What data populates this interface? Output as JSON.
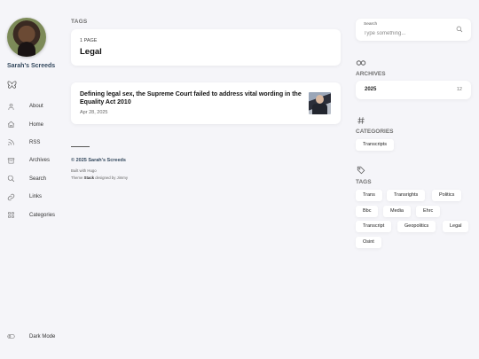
{
  "sidebar": {
    "site_name": "Sarah's Screeds",
    "menu": [
      {
        "label": "About",
        "icon": "user-icon"
      },
      {
        "label": "Home",
        "icon": "home-icon"
      },
      {
        "label": "RSS",
        "icon": "rss-icon"
      },
      {
        "label": "Archives",
        "icon": "archive-icon"
      },
      {
        "label": "Search",
        "icon": "search-icon"
      },
      {
        "label": "Links",
        "icon": "link-icon"
      },
      {
        "label": "Categories",
        "icon": "grid-icon"
      }
    ],
    "dark_mode_label": "Dark Mode"
  },
  "main": {
    "section_label": "TAGS",
    "term_count": "1 PAGE",
    "term": "Legal",
    "article": {
      "title": "Defining legal sex, the Supreme Court failed to address vital wording in the Equality Act 2010",
      "date": "Apr 28, 2025"
    },
    "footer": {
      "copyright": "© 2025 Sarah's Screeds",
      "built_with": "Built with Hugo",
      "theme_prefix": "Theme ",
      "theme_name": "Stack",
      "theme_suffix": " designed by Jimmy"
    }
  },
  "widgets": {
    "search": {
      "label": "Search",
      "placeholder": "Type something..."
    },
    "archives": {
      "title": "ARCHIVES",
      "year": "2025",
      "count": "12"
    },
    "categories": {
      "title": "CATEGORIES",
      "items": [
        "Transcripts"
      ]
    },
    "tags": {
      "title": "TAGS",
      "items": [
        "Trans",
        "Transrights",
        "Politics",
        "Bbc",
        "Media",
        "Ehrc",
        "Transcript",
        "Geopolitics",
        "Legal",
        "Osint"
      ]
    }
  },
  "colors": {
    "accent": "#34495e",
    "background": "#f5f5f9",
    "card": "#ffffff"
  }
}
